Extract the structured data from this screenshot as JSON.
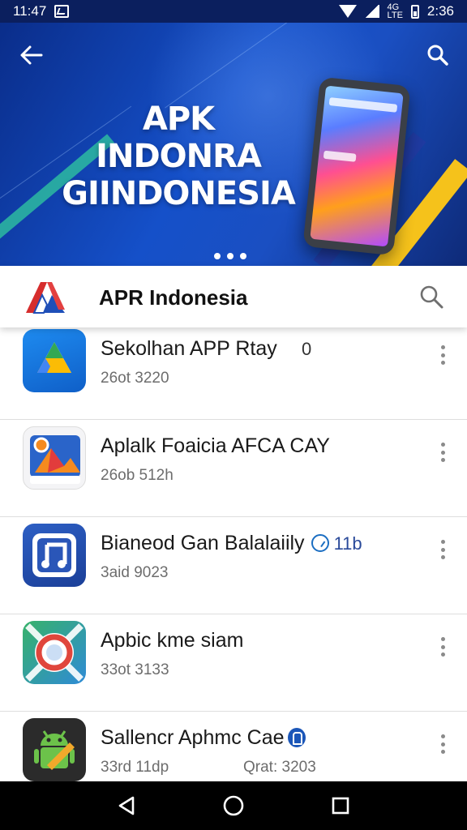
{
  "status_bar": {
    "time_left": "11:47",
    "time_right": "2:36",
    "network_small": "4G\nLTE",
    "icons": [
      "image-notification-icon",
      "wifi-icon",
      "signal-icon",
      "battery-icon"
    ]
  },
  "banner": {
    "title_line1": "APK INDONRA",
    "title_line2": "GIINDONESIA",
    "carousel_dots": 3,
    "icons": [
      "back-arrow-icon",
      "search-icon"
    ]
  },
  "app_header": {
    "title": "APR Indonesia",
    "logo": "apr-indonesia-logo",
    "search_icon": "search-icon"
  },
  "list_items": [
    {
      "name": "Sekolhan APP Rtay",
      "sub": "26ot 3220",
      "trailing": "0",
      "icon": "drive-triangle-icon"
    },
    {
      "name": "Aplalk Foaicia AFCA CAY",
      "sub": "26ob 512h",
      "icon": "photo-app-icon"
    },
    {
      "name": "Bianeod Gan Balalaiily",
      "sub": "3aid 9023",
      "badge_text": "11b",
      "icon": "music-note-icon"
    },
    {
      "name": "Apbic kme siam",
      "sub": "33ot 3133",
      "icon": "target-ring-icon"
    },
    {
      "name": "Sallencr Aphmc Cae",
      "sub": "33rd 11dp",
      "extra": "Qrat: 3203",
      "icon": "android-icon"
    }
  ],
  "colors": {
    "banner_dark": "#0a2d8a",
    "banner_mid": "#1550c9",
    "accent_yellow": "#f5c21b",
    "accent_teal": "#2ec2a0",
    "status_bar_bg": "#0b1f5e"
  },
  "nav_bar": {
    "icons": [
      "back-triangle-icon",
      "home-circle-icon",
      "recents-square-icon"
    ]
  }
}
